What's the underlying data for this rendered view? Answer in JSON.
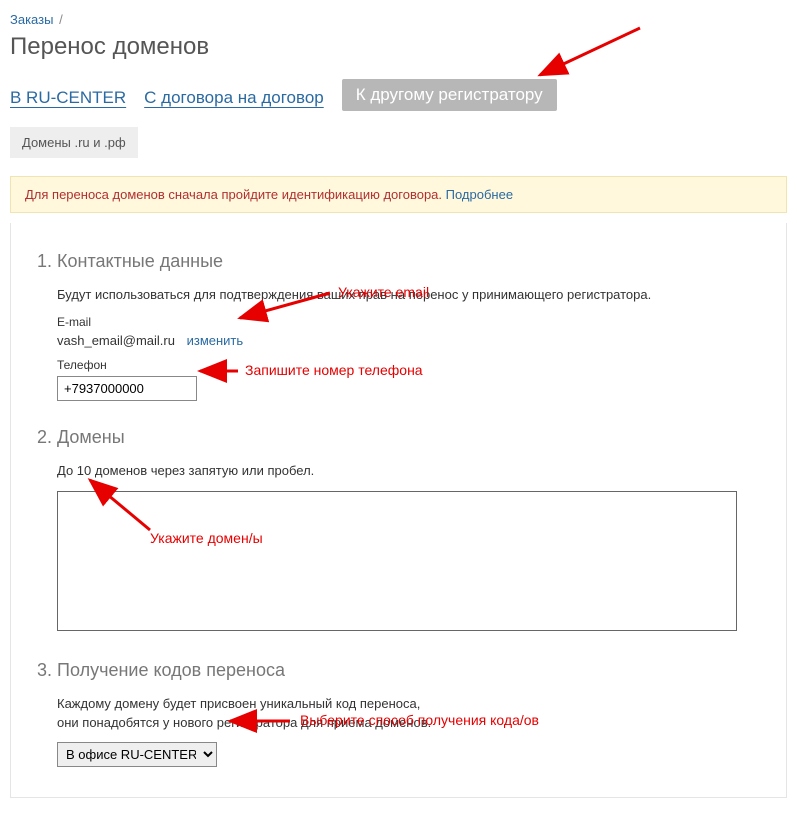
{
  "breadcrumb": {
    "orders": "Заказы",
    "sep": "/"
  },
  "page_title": "Перенос доменов",
  "tabs": {
    "ru_center": "В RU-CENTER",
    "contract": "С договора на договор",
    "other_registrar": "К другому регистратору"
  },
  "subtabs": {
    "ru_rf": "Домены .ru и .рф"
  },
  "notice": {
    "text": "Для переноса доменов сначала пройдите идентификацию договора.",
    "more": "Подробнее"
  },
  "section1": {
    "title": "1. Контактные данные",
    "desc": "Будут использоваться для подтверждения ваших прав на перенос у принимающего регистратора.",
    "email_label": "E-mail",
    "email_value": "vash_email@mail.ru",
    "change": "изменить",
    "phone_label": "Телефон",
    "phone_value": "+7937000000"
  },
  "section2": {
    "title": "2. Домены",
    "desc": "До 10 доменов через запятую или пробел."
  },
  "section3": {
    "title": "3. Получение кодов переноса",
    "desc": "Каждому домену будет присвоен уникальный код переноса,\nони понадобятся у нового регистратора для приема доменов.",
    "select_value": "В офисе RU-CENTER"
  },
  "annotations": {
    "email": "Укажите email",
    "phone": "Запишите номер телефона",
    "domains": "Укажите домен/ы",
    "code": "Выберите способ получения кода/ов"
  }
}
